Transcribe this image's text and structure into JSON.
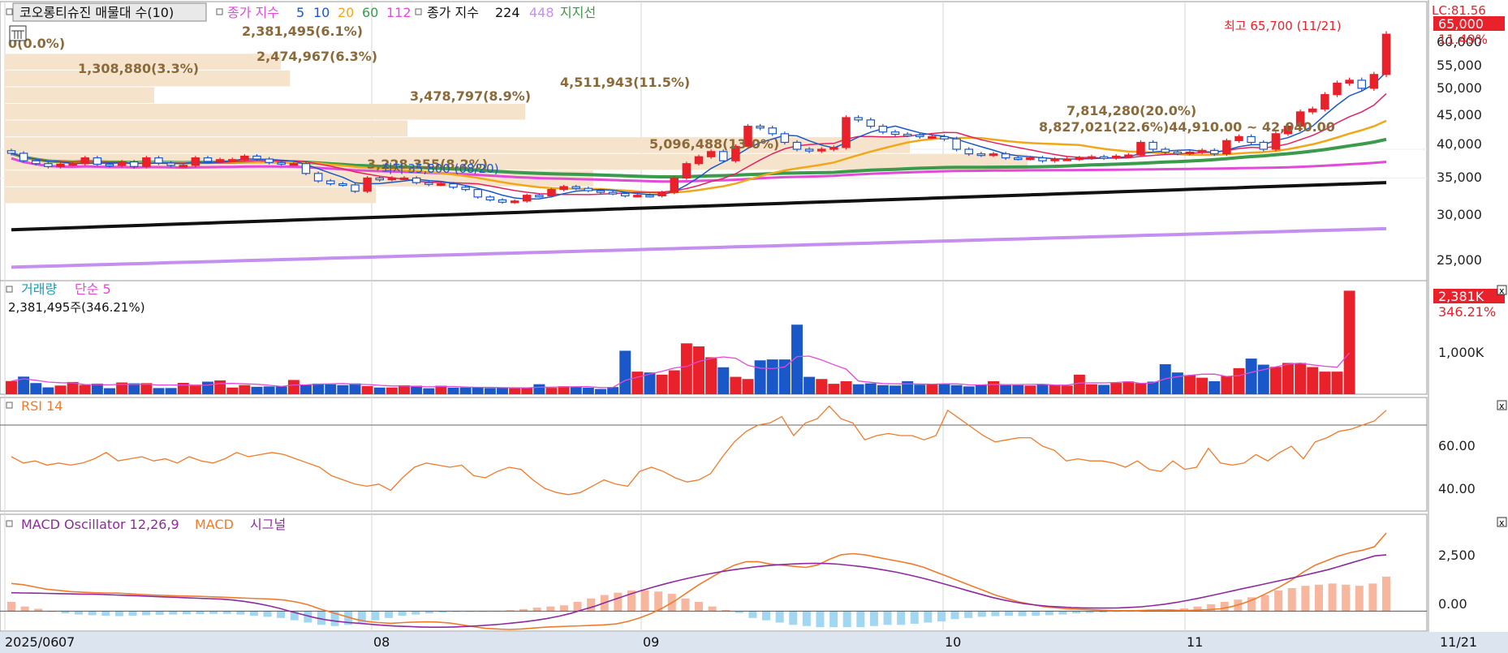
{
  "colors": {
    "up": "#e8212b",
    "down": "#1a57c9",
    "ma5": "#1a57c9",
    "ma10": "#e6205f",
    "ma20": "#f0a818",
    "ma60": "#3a9b4c",
    "ma112": "#e14bd8",
    "ma224": "#111111",
    "ma448": "#c58ff0",
    "profile": "#f6e3cc",
    "rsi": "#f07b2c",
    "macd": "#f07b2c",
    "signal": "#8e2a9e",
    "osc_pos": "#f6b79e",
    "osc_neg": "#a2d7f1",
    "vol_ma": "#e14bd8",
    "axis_bg": "#dce4ef"
  },
  "header": {
    "title": "코오롱티슈진 매물대 수(10)",
    "ma_label_1": "종가 지수",
    "ma_5": "5",
    "ma_10": "10",
    "ma_20": "20",
    "ma_60": "60",
    "ma_112": "112",
    "ma_label_2": "종가 지수",
    "ma_224": "224",
    "ma_448": "448",
    "support": "지지선"
  },
  "price_panel": {
    "lc_label": "LC:81.56",
    "current_price": "65,000",
    "change_pct": "11.49%",
    "high_annotation": "최고 65,700 (11/21)",
    "low_annotation": "최저 35,800 (08/20)",
    "profile_labels": [
      "0(0.0%)",
      "2,381,495(6.1%)",
      "2,474,967(6.3%)",
      "1,308,880(3.3%)",
      "4,511,943(11.5%)",
      "3,478,797(8.9%)",
      "7,814,280(20.0%)",
      "8,827,021(22.6%)44,910.00 ~ 42,040.00",
      "5,096,488(13.0%)",
      "3,228,355(8.2%)"
    ],
    "y_ticks": [
      "60,000",
      "55,000",
      "50,000",
      "45,000",
      "40,000",
      "35,000",
      "30,000",
      "25,000"
    ]
  },
  "volume_panel": {
    "label": "거래량",
    "ma_label": "단순 5",
    "last_value": "2,381,495주(346.21%)",
    "badge": "2,381K",
    "badge_pct": "346.21%",
    "y_tick": "1,000K"
  },
  "rsi_panel": {
    "label": "RSI 14",
    "y_ticks": [
      "60.00",
      "40.00"
    ]
  },
  "macd_panel": {
    "label_osc": "MACD Oscillator 12,26,9",
    "label_macd": "MACD",
    "label_signal": "시그널",
    "y_ticks": [
      "2,500",
      "0.00"
    ]
  },
  "x_axis": {
    "labels": [
      "2025/06",
      "07",
      "08",
      "09",
      "10",
      "11"
    ],
    "last_date": "11/21"
  },
  "chart_data": [
    {
      "type": "candlestick",
      "title": "코오롱티슈진",
      "ylim": [
        23000,
        67000
      ],
      "close": [
        44300,
        43000,
        42500,
        42000,
        42400,
        42500,
        43500,
        42400,
        42200,
        42800,
        42000,
        43500,
        42600,
        42200,
        42200,
        43500,
        42900,
        43200,
        43200,
        43800,
        43300,
        42700,
        42500,
        42500,
        40800,
        39500,
        39000,
        38800,
        37700,
        40000,
        39700,
        40000,
        40000,
        39200,
        38900,
        39000,
        38400,
        38000,
        36700,
        36200,
        35800,
        36000,
        37000,
        36900,
        38000,
        38500,
        38200,
        37800,
        37500,
        37300,
        36900,
        37000,
        36900,
        37500,
        40000,
        42500,
        43700,
        44600,
        43000,
        45500,
        49000,
        48700,
        47700,
        46200,
        45000,
        44700,
        45000,
        45300,
        50500,
        50100,
        49000,
        48000,
        47600,
        47500,
        47200,
        47200,
        46800,
        45000,
        44200,
        44000,
        44200,
        43500,
        43400,
        43500,
        43000,
        43300,
        43300,
        43500,
        43700,
        43500,
        43800,
        44000,
        46200,
        45000,
        44500,
        44300,
        44500,
        44800,
        44200,
        46500,
        47200,
        46200,
        45000,
        47700,
        49000,
        51500,
        52000,
        54500,
        56500,
        57000,
        55600,
        58000,
        65000
      ],
      "volume_k": [
        303,
        405,
        257,
        158,
        200,
        282,
        214,
        243,
        139,
        270,
        251,
        255,
        142,
        143,
        261,
        220,
        289,
        318,
        154,
        211,
        171,
        180,
        179,
        328,
        224,
        245,
        229,
        210,
        248,
        186,
        154,
        155,
        207,
        195,
        138,
        195,
        151,
        155,
        152,
        143,
        155,
        138,
        140,
        230,
        147,
        183,
        160,
        150,
        122,
        165,
        1000,
        520,
        500,
        450,
        550,
        1170,
        1100,
        850,
        620,
        400,
        350,
        780,
        800,
        800,
        1600,
        400,
        350,
        240,
        300,
        230,
        250,
        210,
        200,
        300,
        220,
        230,
        240,
        210,
        180,
        210,
        300,
        210,
        210,
        200,
        225,
        210,
        200,
        450,
        230,
        215,
        260,
        295,
        250,
        290,
        690,
        500,
        440,
        380,
        300,
        420,
        600,
        820,
        680,
        630,
        720,
        720,
        625,
        520,
        520,
        2381
      ]
    },
    {
      "type": "line",
      "title": "RSI 14",
      "ylim": [
        30,
        80
      ],
      "values": [
        55,
        52,
        53,
        51,
        52,
        51,
        52,
        54,
        57,
        53,
        54,
        55,
        53,
        54,
        52,
        55,
        53,
        52,
        54,
        57,
        55,
        56,
        57,
        56,
        54,
        52,
        50,
        46,
        44,
        42,
        41,
        42,
        39,
        45,
        50,
        52,
        51,
        50,
        51,
        46,
        45,
        48,
        50,
        49,
        44,
        40,
        38,
        37,
        38,
        41,
        44,
        42,
        41,
        48,
        50,
        48,
        45,
        43,
        44,
        47,
        55,
        62,
        67,
        70,
        71,
        74,
        65,
        71,
        73,
        79,
        73,
        71,
        63,
        65,
        66,
        65,
        65,
        63,
        65,
        77,
        73,
        69,
        65,
        62,
        63,
        64,
        64,
        60,
        58,
        53,
        54,
        53,
        53,
        52,
        50,
        53,
        49,
        48,
        53,
        49,
        50,
        59,
        52,
        51,
        52,
        56,
        53,
        57,
        60,
        54,
        62,
        64,
        67,
        68,
        70,
        72,
        77
      ]
    },
    {
      "type": "line",
      "title": "MACD Oscillator 12,26,9",
      "ylim": [
        -800,
        4000
      ],
      "series": [
        {
          "name": "MACD",
          "values": [
            1200,
            1150,
            1050,
            950,
            900,
            850,
            820,
            800,
            790,
            780,
            750,
            720,
            700,
            680,
            660,
            650,
            640,
            620,
            600,
            580,
            560,
            540,
            520,
            480,
            400,
            280,
            100,
            -50,
            -200,
            -350,
            -450,
            -500,
            -530,
            -500,
            -480,
            -470,
            -480,
            -520,
            -600,
            -680,
            -750,
            -780,
            -800,
            -780,
            -740,
            -700,
            -680,
            -660,
            -640,
            -620,
            -600,
            -560,
            -450,
            -300,
            -100,
            150,
            450,
            800,
            1150,
            1450,
            1750,
            2000,
            2150,
            2150,
            2050,
            2000,
            1950,
            1900,
            2000,
            2250,
            2450,
            2500,
            2450,
            2350,
            2250,
            2150,
            2050,
            1900,
            1700,
            1500,
            1300,
            1100,
            900,
            700,
            550,
            400,
            300,
            200,
            150,
            100,
            80,
            60,
            40,
            20,
            20,
            20,
            40,
            50,
            40,
            30,
            40,
            60,
            100,
            200,
            350,
            550,
            800,
            1050,
            1350,
            1700,
            2000,
            2200,
            2400,
            2550,
            2650,
            2800,
            3400
          ]
        },
        {
          "name": "시그널",
          "values": [
            800,
            790,
            780,
            770,
            760,
            750,
            740,
            730,
            720,
            700,
            680,
            660,
            640,
            620,
            600,
            580,
            560,
            540,
            520,
            480,
            420,
            340,
            240,
            120,
            -20,
            -150,
            -280,
            -380,
            -450,
            -500,
            -540,
            -580,
            -620,
            -650,
            -670,
            -690,
            -700,
            -700,
            -690,
            -670,
            -640,
            -610,
            -570,
            -520,
            -470,
            -400,
            -320,
            -220,
            -100,
            50,
            200,
            380,
            550,
            720,
            880,
            1030,
            1170,
            1300,
            1420,
            1530,
            1630,
            1720,
            1800,
            1870,
            1930,
            1980,
            2020,
            2050,
            2070,
            2080,
            2070,
            2040,
            1990,
            1930,
            1860,
            1780,
            1690,
            1580,
            1460,
            1330,
            1190,
            1050,
            900,
            760,
            620,
            500,
            400,
            320,
            260,
            210,
            180,
            150,
            140,
            130,
            130,
            140,
            160,
            190,
            240,
            300,
            380,
            470,
            570,
            680,
            790,
            900,
            1010,
            1120,
            1230,
            1340,
            1450,
            1560,
            1680,
            1800,
            1950,
            2100,
            2250,
            2400,
            2450
          ]
        },
        {
          "name": "MACD Oscillator 12,26,9",
          "values": [
            400,
            200,
            100,
            0,
            -100,
            -150,
            -180,
            -200,
            -220,
            -200,
            -180,
            -160,
            -150,
            -140,
            -130,
            -120,
            -120,
            -150,
            -200,
            -250,
            -300,
            -400,
            -500,
            -600,
            -650,
            -600,
            -500,
            -400,
            -300,
            -200,
            -150,
            -100,
            -60,
            -40,
            -20,
            -10,
            10,
            40,
            90,
            150,
            200,
            250,
            400,
            550,
            700,
            800,
            900,
            900,
            850,
            750,
            550,
            400,
            200,
            50,
            -80,
            -300,
            -400,
            -500,
            -600,
            -650,
            -700,
            -700,
            -700,
            -700,
            -650,
            -600,
            -600,
            -550,
            -500,
            -450,
            -350,
            -300,
            -250,
            -220,
            -200,
            -220,
            -200,
            -180,
            -150,
            -100,
            -80,
            -60,
            -40,
            -20,
            0,
            50,
            80,
            120,
            200,
            300,
            400,
            500,
            600,
            700,
            900,
            1000,
            1100,
            1150,
            1200,
            1150,
            1100,
            1200,
            1500
          ]
        }
      ]
    }
  ]
}
